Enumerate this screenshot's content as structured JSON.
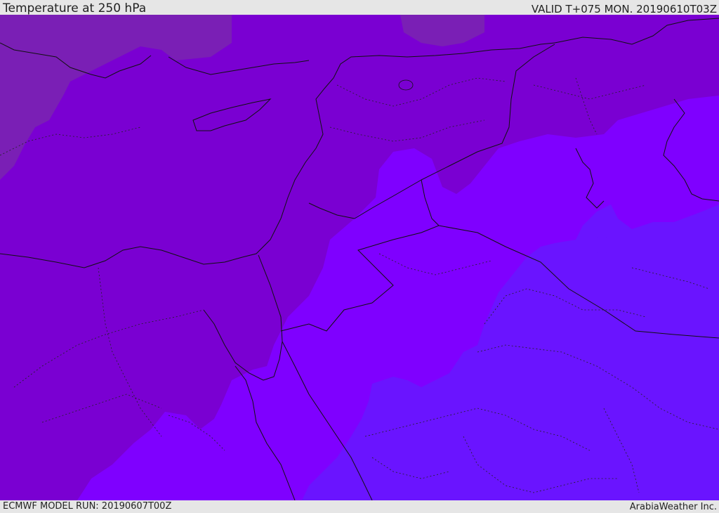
{
  "header": {
    "title": "Temperature at 250 hPa",
    "valid": "VALID T+075 MON. 20190610T03Z"
  },
  "footer": {
    "model_run": "ECMWF MODEL RUN: 20190607T00Z",
    "credit": "ArabiaWeather Inc."
  },
  "map": {
    "field": "temperature",
    "level": "250 hPa",
    "colors": {
      "coldest": "#7a1fb5",
      "cold": "#7a00d2",
      "mid": "#7f00ff",
      "warm": "#6a14ff",
      "border": "#111111"
    }
  }
}
